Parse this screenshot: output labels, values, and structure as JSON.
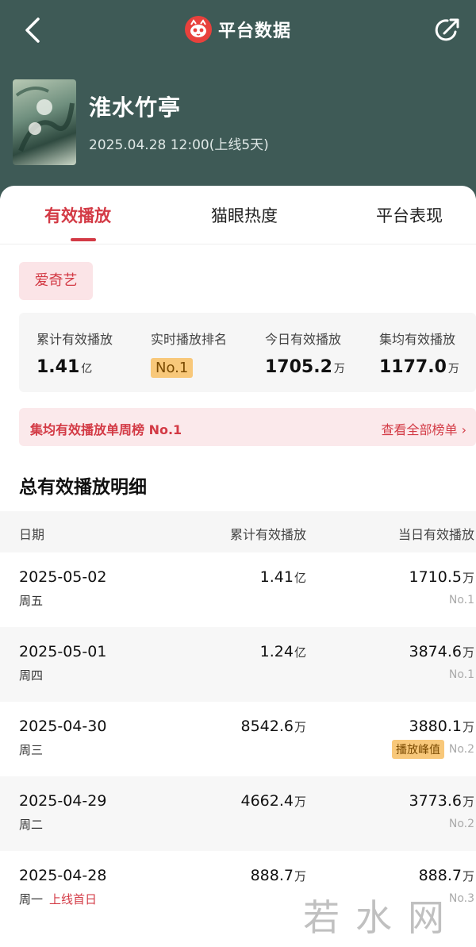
{
  "header": {
    "title": "平台数据",
    "show_title": "淮水竹亭",
    "show_date": "2025.04.28 12:00(上线5天)"
  },
  "tabs": [
    {
      "label": "有效播放"
    },
    {
      "label": "猫眼热度"
    },
    {
      "label": "平台表现"
    }
  ],
  "platform": "爱奇艺",
  "stats": {
    "total": {
      "label": "累计有效播放",
      "value": "1.41",
      "unit": "亿"
    },
    "rank": {
      "label": "实时播放排名",
      "value": "No.1"
    },
    "today": {
      "label": "今日有效播放",
      "value": "1705.2",
      "unit": "万"
    },
    "avg": {
      "label": "集均有效播放",
      "value": "1177.0",
      "unit": "万"
    }
  },
  "weekly": {
    "text": "集均有效播放单周榜 No.1",
    "link": "查看全部榜单 ›"
  },
  "section_title": "总有效播放明细",
  "table": {
    "headers": {
      "date": "日期",
      "total": "累计有效播放",
      "daily": "当日有效播放"
    },
    "rows": [
      {
        "date": "2025-05-02",
        "weekday": "周五",
        "first_day": "",
        "total": "1.41",
        "total_unit": "亿",
        "daily": "1710.5",
        "daily_unit": "万",
        "rank": "No.1",
        "peak": ""
      },
      {
        "date": "2025-05-01",
        "weekday": "周四",
        "first_day": "",
        "total": "1.24",
        "total_unit": "亿",
        "daily": "3874.6",
        "daily_unit": "万",
        "rank": "No.1",
        "peak": ""
      },
      {
        "date": "2025-04-30",
        "weekday": "周三",
        "first_day": "",
        "total": "8542.6",
        "total_unit": "万",
        "daily": "3880.1",
        "daily_unit": "万",
        "rank": "No.2",
        "peak": "播放峰值"
      },
      {
        "date": "2025-04-29",
        "weekday": "周二",
        "first_day": "",
        "total": "4662.4",
        "total_unit": "万",
        "daily": "3773.6",
        "daily_unit": "万",
        "rank": "No.2",
        "peak": ""
      },
      {
        "date": "2025-04-28",
        "weekday": "周一",
        "first_day": "上线首日",
        "total": "888.7",
        "total_unit": "万",
        "daily": "888.7",
        "daily_unit": "万",
        "rank": "No.3",
        "peak": ""
      }
    ]
  },
  "watermark": "若水网",
  "colors": {
    "header_bg": "#3e5a56",
    "accent": "#d33a45",
    "badge": "#f8c87a"
  },
  "icons": {
    "back": "chevron-left-icon",
    "logo": "maoyan-cat-logo-icon",
    "share": "share-icon"
  }
}
